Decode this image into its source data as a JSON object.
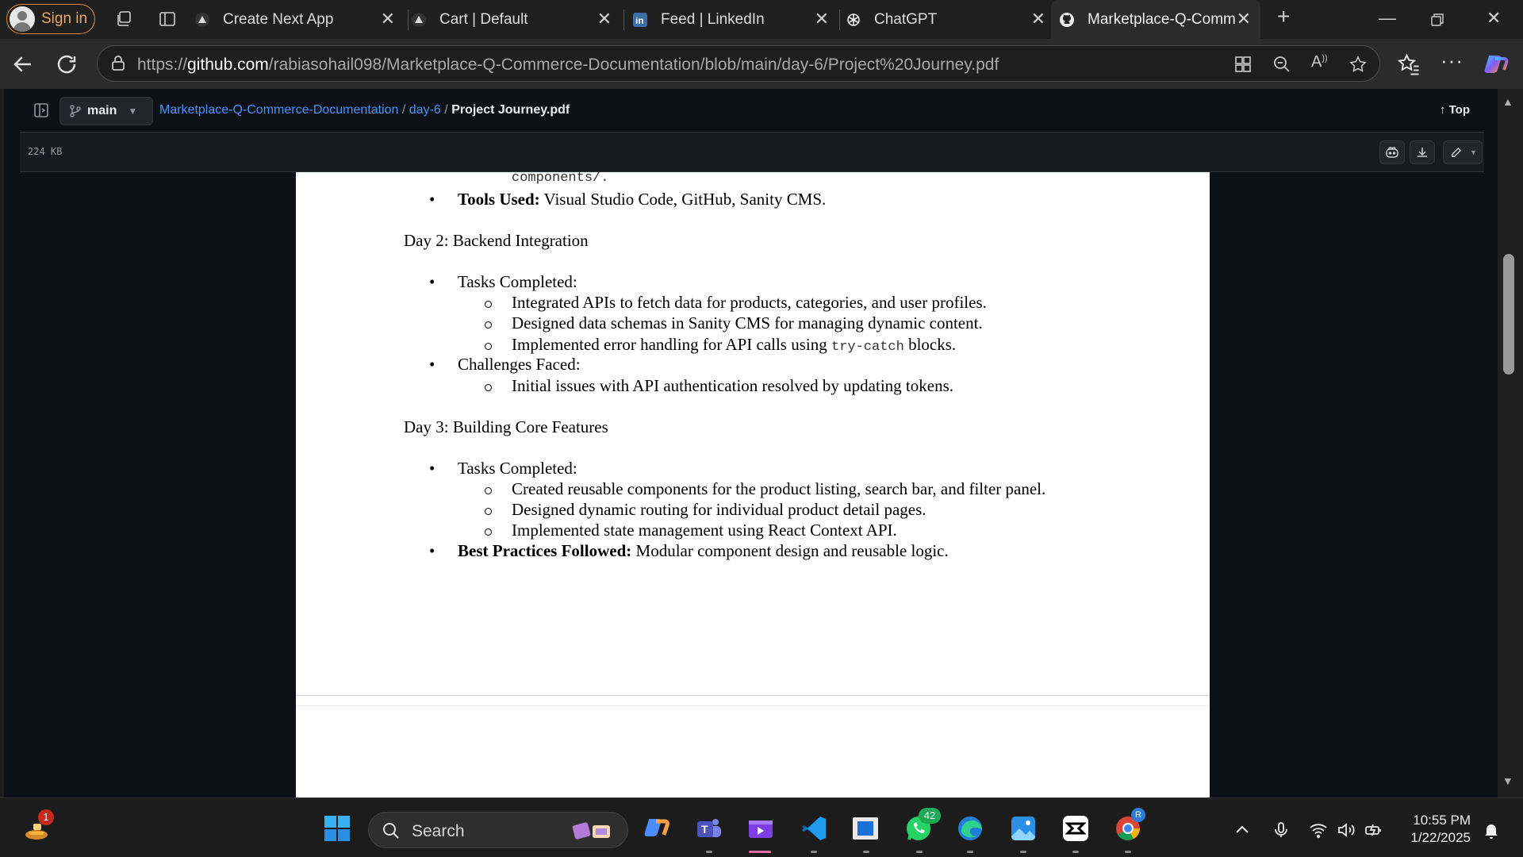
{
  "browser": {
    "signin_label": "Sign in",
    "tabs": [
      {
        "label": "Create Next App"
      },
      {
        "label": "Cart | Default"
      },
      {
        "label": "Feed | LinkedIn"
      },
      {
        "label": "ChatGPT"
      },
      {
        "label": "Marketplace-Q-Comm"
      }
    ],
    "url_host": "github.com",
    "url_prefix": "https://",
    "url_path": "/rabiasohail098/Marketplace-Q-Commerce-Documentation/blob/main/day-6/Project%20Journey.pdf"
  },
  "github": {
    "branch": "main",
    "breadcrumb": {
      "repo": "Marketplace-Q-Commerce-Documentation",
      "sep1": "/",
      "folder": "day-6",
      "sep2": "/",
      "file": "Project Journey.pdf"
    },
    "top_label": "Top",
    "file_size": "224 KB"
  },
  "document": {
    "top_fragment": "components/.",
    "tools_used_label": "Tools Used:",
    "tools_used_text": " Visual Studio Code, GitHub, Sanity CMS.",
    "day2_heading": "Day 2: Backend Integration",
    "day2_tasks_label": "Tasks Completed:",
    "day2_tasks": [
      "Integrated APIs to fetch data for products, categories, and user profiles.",
      "Designed data schemas in Sanity CMS for managing dynamic content."
    ],
    "day2_task3_pre": "Implemented error handling for API calls using ",
    "day2_task3_code": "try-catch",
    "day2_task3_post": " blocks.",
    "day2_challenges_label": "Challenges Faced:",
    "day2_challenges": [
      "Initial issues with API authentication resolved by updating tokens."
    ],
    "day3_heading": "Day 3: Building Core Features",
    "day3_tasks_label": "Tasks Completed:",
    "day3_tasks": [
      "Created reusable components for the product listing, search bar, and filter panel.",
      "Designed dynamic routing for individual product detail pages.",
      "Implemented state management using React Context API."
    ],
    "day3_bp_label": "Best Practices Followed:",
    "day3_bp_text": " Modular component design and reusable logic."
  },
  "taskbar": {
    "search_label": "Search",
    "whatsapp_badge": "42",
    "weather_badge": "1",
    "time": "10:55 PM",
    "date": "1/22/2025"
  },
  "colors": {
    "accent_link": "#4493f8",
    "signin_border": "#d9893d",
    "page_bg": "#0d1117"
  }
}
